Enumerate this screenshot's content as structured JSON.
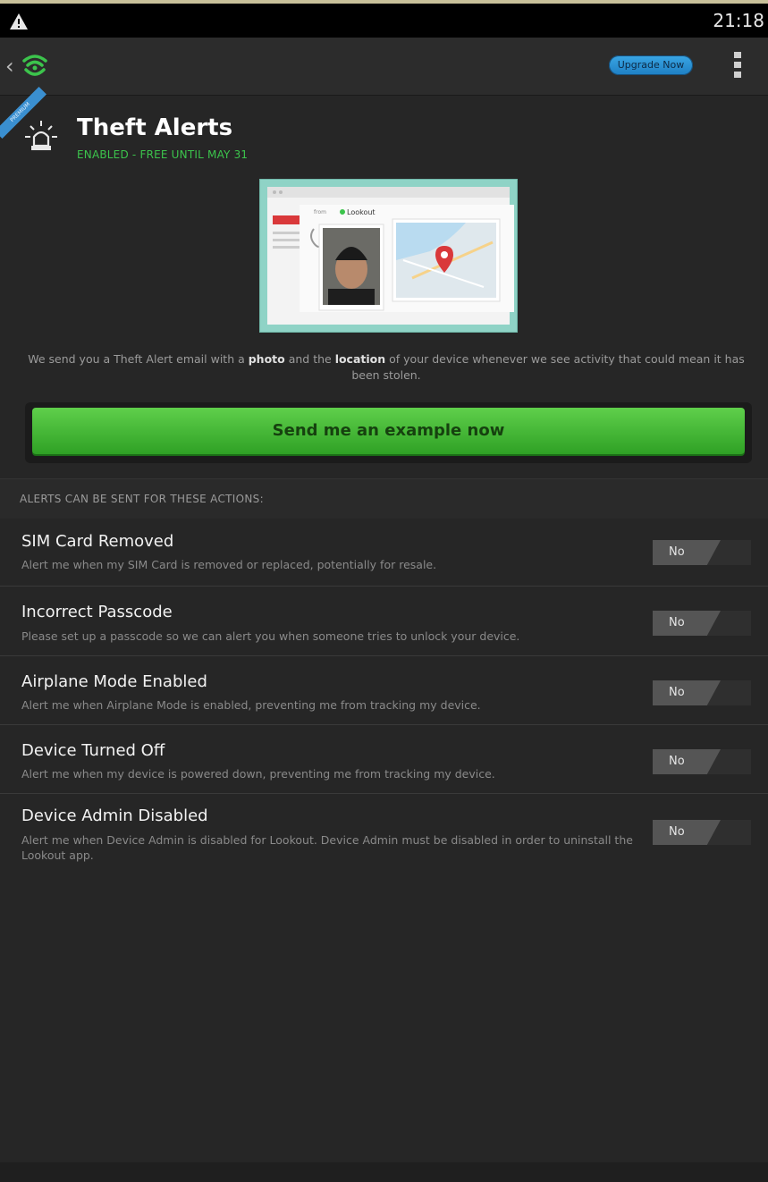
{
  "status_bar": {
    "time": "21:18",
    "warning_icon": "warning-triangle-icon"
  },
  "action_bar": {
    "back_icon": "back-chevron-icon",
    "logo_icon": "lookout-shield-icon",
    "upgrade_label": "Upgrade Now",
    "overflow_icon": "overflow-menu-icon"
  },
  "feature": {
    "ribbon": "PREMIUM",
    "icon": "siren-icon",
    "title": "Theft Alerts",
    "status": "ENABLED - FREE UNTIL MAY 31"
  },
  "illustration": {
    "brand": "Lookout",
    "icons": [
      "email-icon",
      "person-photo",
      "map-pin-icon"
    ]
  },
  "description": {
    "part1": "We send you a Theft Alert email with a ",
    "bold1": "photo",
    "part2": " and the ",
    "bold2": "location",
    "part3": " of your device whenever we see activity that could mean it has been stolen."
  },
  "cta": {
    "label": "Send me an example now"
  },
  "alerts_section": {
    "header": "ALERTS CAN BE SENT FOR THESE ACTIONS:",
    "items": [
      {
        "title": "SIM Card Removed",
        "subtitle": "Alert me when my SIM Card is removed or replaced, potentially for resale.",
        "toggle": "No"
      },
      {
        "title": "Incorrect Passcode",
        "subtitle": "Please set up a passcode so we can alert you when someone tries to unlock your device.",
        "toggle": "No"
      },
      {
        "title": "Airplane Mode Enabled",
        "subtitle": "Alert me when Airplane Mode is enabled, preventing me from tracking my device.",
        "toggle": "No"
      },
      {
        "title": "Device Turned Off",
        "subtitle": "Alert me when my device is powered down, preventing me from tracking my device.",
        "toggle": "No"
      },
      {
        "title": "Device Admin Disabled",
        "subtitle": "Alert me when Device Admin is disabled for Lookout. Device Admin must be disabled in order to uninstall the Lookout app.",
        "toggle": "No"
      }
    ]
  },
  "colors": {
    "accent_green": "#3cc44c",
    "button_green": "#2fa125",
    "upgrade_blue": "#2a93d8",
    "background": "#262626"
  }
}
